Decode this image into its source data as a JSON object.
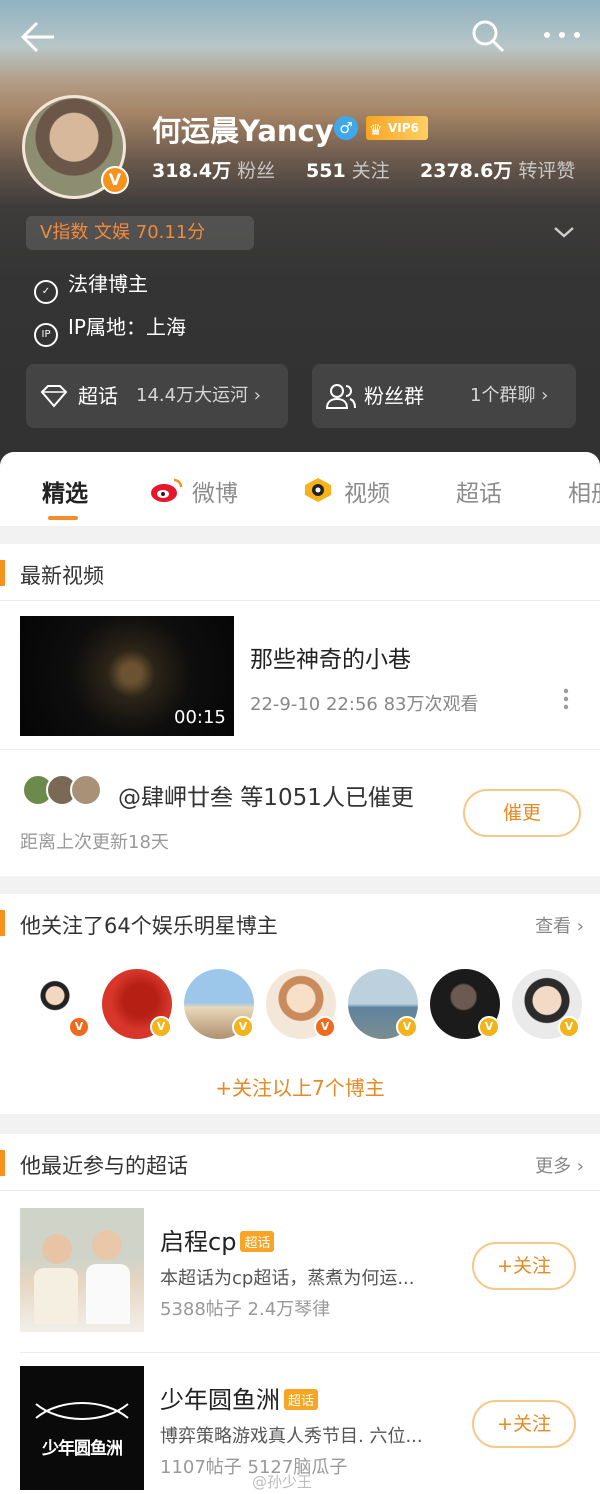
{
  "profile": {
    "name": "何运晨Yancy",
    "gender_icon": "♂",
    "vip_label": "VIP6",
    "followers_value": "318.4万",
    "followers_label": "粉丝",
    "following_value": "551",
    "following_label": "关注",
    "reposts_value": "2378.6万",
    "reposts_label": "转评赞",
    "v_index": "V指数 文娱 70.11分",
    "verification": "法律博主",
    "ip_location": "IP属地：上海"
  },
  "pills": {
    "super_topic_label": "超话",
    "super_topic_value": "14.4万大运河 ›",
    "fan_group_label": "粉丝群",
    "fan_group_value": "1个群聊 ›"
  },
  "tabs": [
    "精选",
    "微博",
    "视频",
    "超话",
    "相册"
  ],
  "latest_video": {
    "section_title": "最新视频",
    "duration": "00:15",
    "title": "那些神奇的小巷",
    "meta": "22-9-10 22:56 83万次观看",
    "urge_text": "@肆岬廿叁 等1051人已催更",
    "since_text": "距离上次更新18天",
    "urge_button": "催更"
  },
  "following": {
    "section_title": "他关注了64个娱乐明星博主",
    "link_label": "查看 ›",
    "follow_all_label": "+关注以上7个博主"
  },
  "super_topics": {
    "section_title": "他最近参与的超话",
    "link_label": "更多 ›",
    "items": [
      {
        "title": "启程cp",
        "tag": "超话",
        "desc": "本超话为cp超话，蒸煮为何运...",
        "meta": "5388帖子 2.4万琴律",
        "button": "+关注"
      },
      {
        "title": "少年圆鱼洲",
        "tag": "超话",
        "desc": "博弈策略游戏真人秀节目. 六位...",
        "meta": "1107帖子 5127脑瓜子",
        "button": "+关注",
        "logo_text": "少年圆鱼洲"
      }
    ]
  },
  "watermark": "@孙少王",
  "colors": {
    "accent": "#f7921d",
    "orange_text": "#e58a25",
    "vip_gold": "#f6a524",
    "verify_blue": "#3fa8ea"
  }
}
